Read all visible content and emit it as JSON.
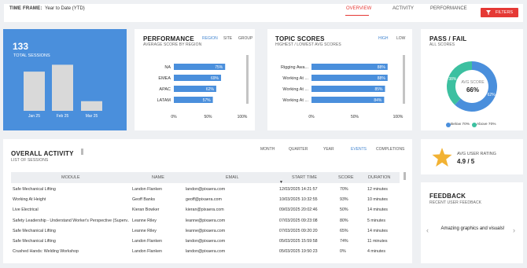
{
  "topbar": {
    "time_frame_label": "TIME FRAME:",
    "time_frame_value": "Year to Date (YTD)",
    "nav": [
      "OVERVIEW",
      "ACTIVITY",
      "PERFORMANCE"
    ],
    "filters_label": "FILTERS"
  },
  "sessions": {
    "count": "133",
    "label": "TOTAL SESSIONS",
    "chart_data": {
      "type": "bar",
      "categories": [
        "Jan 25",
        "Feb 25",
        "Mar 25"
      ],
      "values": [
        57,
        67,
        14
      ],
      "ylim": [
        0,
        80
      ]
    }
  },
  "performance": {
    "title": "PERFORMANCE",
    "subtitle": "AVERAGE SCORE BY REGION",
    "tabs": [
      "REGION",
      "SITE",
      "GROUP"
    ],
    "chart_data": {
      "type": "bar",
      "orientation": "horizontal",
      "categories": [
        "NA",
        "EMEA",
        "APAC",
        "LATAM"
      ],
      "values": [
        75,
        69,
        62,
        57
      ],
      "value_labels": [
        "75%",
        "69%",
        "62%",
        "57%"
      ],
      "ticks": [
        "0%",
        "50%",
        "100%"
      ],
      "xlim": [
        0,
        100
      ]
    }
  },
  "topic_scores": {
    "title": "TOPIC SCORES",
    "subtitle": "HIGHEST / LOWEST AVG SCORES",
    "tabs": [
      "HIGH",
      "LOW"
    ],
    "chart_data": {
      "type": "bar",
      "orientation": "horizontal",
      "categories": [
        "Rigging Awa...",
        "Working At ...",
        "Working At ...",
        "Working At ..."
      ],
      "values": [
        88,
        88,
        85,
        84
      ],
      "value_labels": [
        "88%",
        "88%",
        "85%",
        "84%"
      ],
      "ticks": [
        "0%",
        "50%",
        "100%"
      ],
      "xlim": [
        0,
        100
      ]
    }
  },
  "pass_fail": {
    "title": "PASS / FAIL",
    "subtitle": "ALL SCORES",
    "center_label": "AVG SCORE",
    "center_value": "66%",
    "chart_data": {
      "type": "pie",
      "categories": [
        "Below 70%",
        "Above 70%"
      ],
      "values": [
        38,
        62
      ],
      "value_labels": [
        "38%",
        "62%"
      ],
      "colors": [
        "#4a8fdc",
        "#3cc0a0"
      ]
    },
    "legend": [
      "Below 70%",
      "Above 70%"
    ]
  },
  "activity": {
    "title": "OVERALL ACTIVITY",
    "subtitle": "LIST OF SESSIONS",
    "tabs": [
      "MONTH",
      "QUARTER",
      "YEAR",
      "EVENTS",
      "COMPLETIONS"
    ],
    "columns": [
      "MODULE",
      "NAME",
      "EMAIL",
      "START TIME",
      "SCORE",
      "DURATION"
    ],
    "rows": [
      [
        "Safe Mechanical Lifting",
        "Landon Flanken",
        "landon@pixaera.com",
        "12/03/2025 14:21:57",
        "70%",
        "12 minutes"
      ],
      [
        "Working At Height",
        "Geoff Banks",
        "geoff@pixaera.com",
        "10/03/2025 10:32:55",
        "93%",
        "10 minutes"
      ],
      [
        "Live Electrical",
        "Kieran Bowker",
        "kieran@pixaera.com",
        "09/03/2025 20:02:46",
        "50%",
        "14 minutes"
      ],
      [
        "Safety Leadership - Understand Worker's Perspective (Superv...",
        "Leanne Riley",
        "leanne@pixaera.com",
        "07/03/2025 09:23:08",
        "80%",
        "5 minutes"
      ],
      [
        "Safe Mechanical Lifting",
        "Leanne Riley",
        "leanne@pixaera.com",
        "07/03/2025 09:20:20",
        "65%",
        "14 minutes"
      ],
      [
        "Safe Mechanical Lifting",
        "Landon Flanken",
        "landon@pixaera.com",
        "05/03/2025 15:59:58",
        "74%",
        "11 minutes"
      ],
      [
        "Crushed Hands: Welding Workshop",
        "Landon Flanken",
        "landon@pixaera.com",
        "05/03/2025 19:50:23",
        "0%",
        "4 minutes"
      ]
    ]
  },
  "rating": {
    "label": "AVG USER RATING",
    "value": "4.9 / 5"
  },
  "feedback": {
    "title": "FEEDBACK",
    "subtitle": "RECENT USER FEEDBACK",
    "quote": "Amazing graphics and visuals!"
  }
}
